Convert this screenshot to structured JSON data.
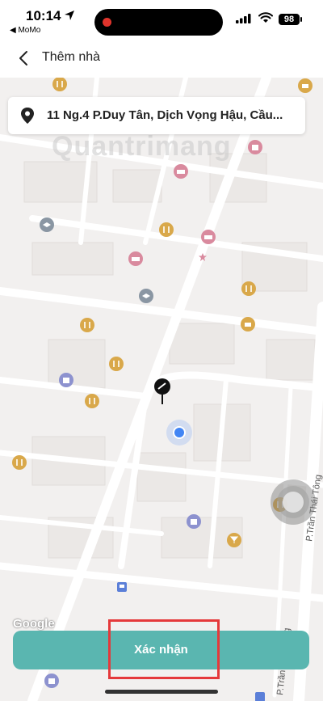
{
  "status_bar": {
    "time": "10:14",
    "back_app": "◀ MoMo",
    "battery": "98"
  },
  "header": {
    "title": "Thêm nhà",
    "back_icon": "chevron-left-icon"
  },
  "address": {
    "text": "11 Ng.4 P.Duy Tân, Dịch Vọng Hậu, Cầu...",
    "icon": "location-pin-icon"
  },
  "watermark": "Quantrimang",
  "map": {
    "attribution": "Google",
    "street_labels": [
      "P.Trần Thái Tông",
      "P.Trần Thái Tông"
    ]
  },
  "confirm_button": {
    "label": "Xác nhận"
  },
  "colors": {
    "map_bg": "#f2f0ef",
    "road": "#ffffff",
    "button": "#5ab6b0",
    "highlight": "#e5393b",
    "poi_food": "#d9a84a",
    "poi_hotel": "#d98a9e",
    "poi_school": "#8a96a3",
    "poi_shop": "#8d92cf",
    "user_location": "#4285f4"
  }
}
